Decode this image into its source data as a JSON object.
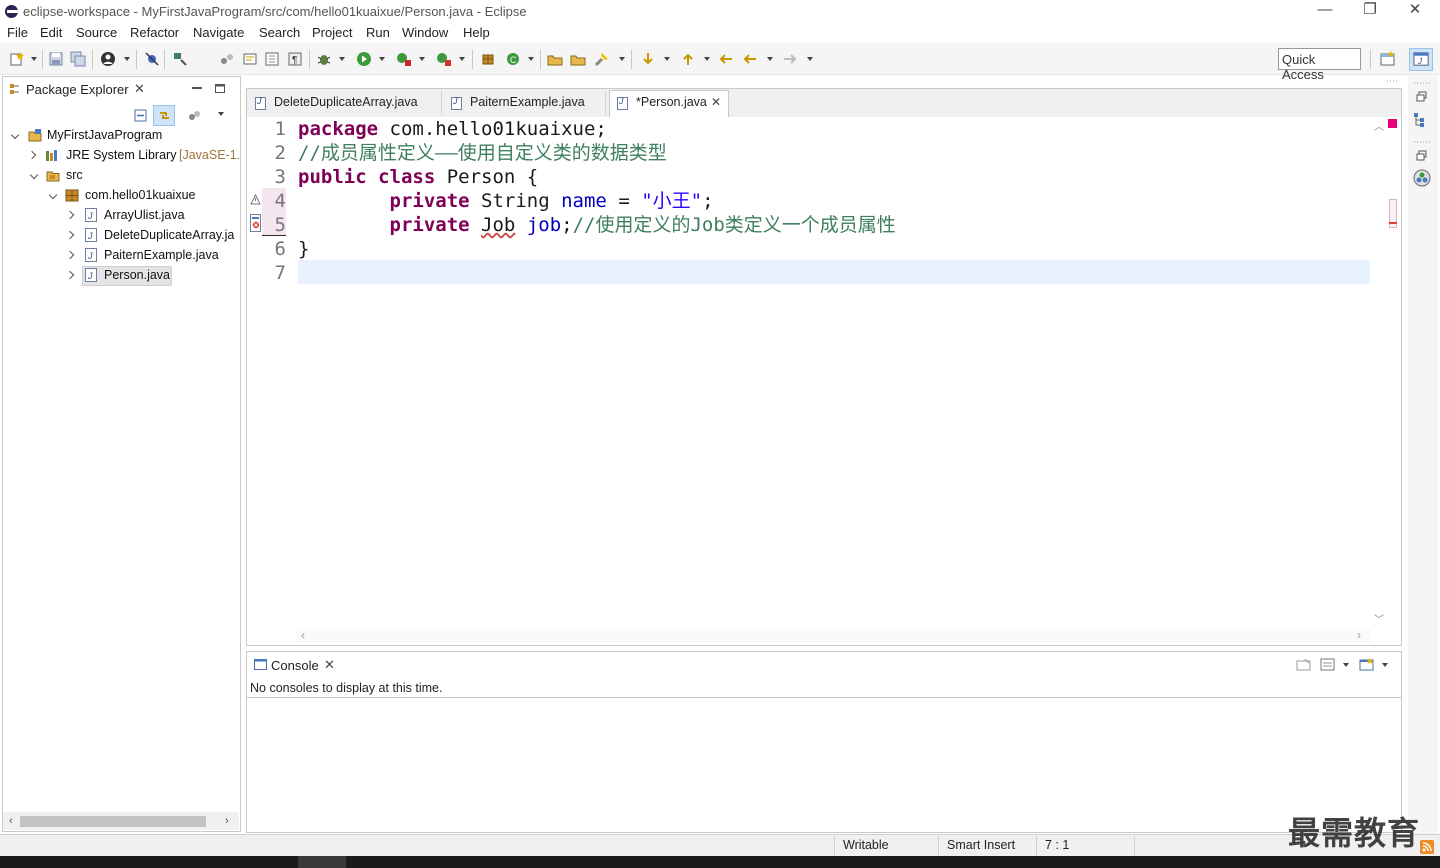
{
  "window": {
    "title": "eclipse-workspace - MyFirstJavaProgram/src/com/hello01kuaixue/Person.java - Eclipse",
    "minimize": "—",
    "restore": "❐",
    "close": "✕"
  },
  "menu": {
    "items": [
      "File",
      "Edit",
      "Source",
      "Refactor",
      "Navigate",
      "Search",
      "Project",
      "Run",
      "Window",
      "Help"
    ]
  },
  "toolbar": {
    "quick_access": "Quick Access"
  },
  "package_explorer": {
    "title": "Package Explorer",
    "close": "✕",
    "tree": [
      {
        "label": "MyFirstJavaProgram",
        "icon": "project-icon"
      },
      {
        "label": "JRE System Library",
        "suffix": "[JavaSE-1.",
        "icon": "library-icon"
      },
      {
        "label": "src",
        "icon": "source-folder-icon"
      },
      {
        "label": "com.hello01kuaixue",
        "icon": "package-icon"
      },
      {
        "label": "ArrayUlist.java",
        "icon": "java-file-icon"
      },
      {
        "label": "DeleteDuplicateArray.ja",
        "icon": "java-file-icon"
      },
      {
        "label": "PaiternExample.java",
        "icon": "java-file-icon"
      },
      {
        "label": "Person.java",
        "icon": "java-file-icon"
      }
    ]
  },
  "editor": {
    "tabs": [
      {
        "label": "DeleteDuplicateArray.java"
      },
      {
        "label": "PaiternExample.java"
      },
      {
        "label": "*Person.java",
        "close": "✕"
      }
    ],
    "line_numbers": [
      "1",
      "2",
      "3",
      "4",
      "5",
      "6",
      "7"
    ],
    "code": {
      "l1_kw": "package",
      "l1_rest": " com.hello01kuaixue;",
      "l2_cmt": "//成员属性定义——使用自定义类的数据类型",
      "l3_kw": "public class",
      "l3_rest": " Person {",
      "l4_indent": "        ",
      "l4_kw": "private",
      "l4_type": " String ",
      "l4_field": "name",
      "l4_eq": " = ",
      "l4_str": "\"小王\"",
      "l4_end": ";",
      "l5_indent": "        ",
      "l5_kw": "private",
      "l5_sp": " ",
      "l5_type": "Job",
      "l5_sp2": " ",
      "l5_field": "job",
      "l5_semi": ";",
      "l5_cmt": "//使用定义的Job类定义一个成员属性",
      "l6": "}"
    }
  },
  "console": {
    "title": "Console",
    "close": "✕",
    "message": "No consoles to display at this time."
  },
  "status_bar": {
    "writable": "Writable",
    "insert_mode": "Smart Insert",
    "position": "7 : 1"
  },
  "watermark": "最需教育",
  "colors": {
    "keyword": "#7f0055",
    "field": "#0000c0",
    "string": "#2a00ff",
    "comment": "#3f7f5f",
    "current_line": "#e8f2fe"
  }
}
